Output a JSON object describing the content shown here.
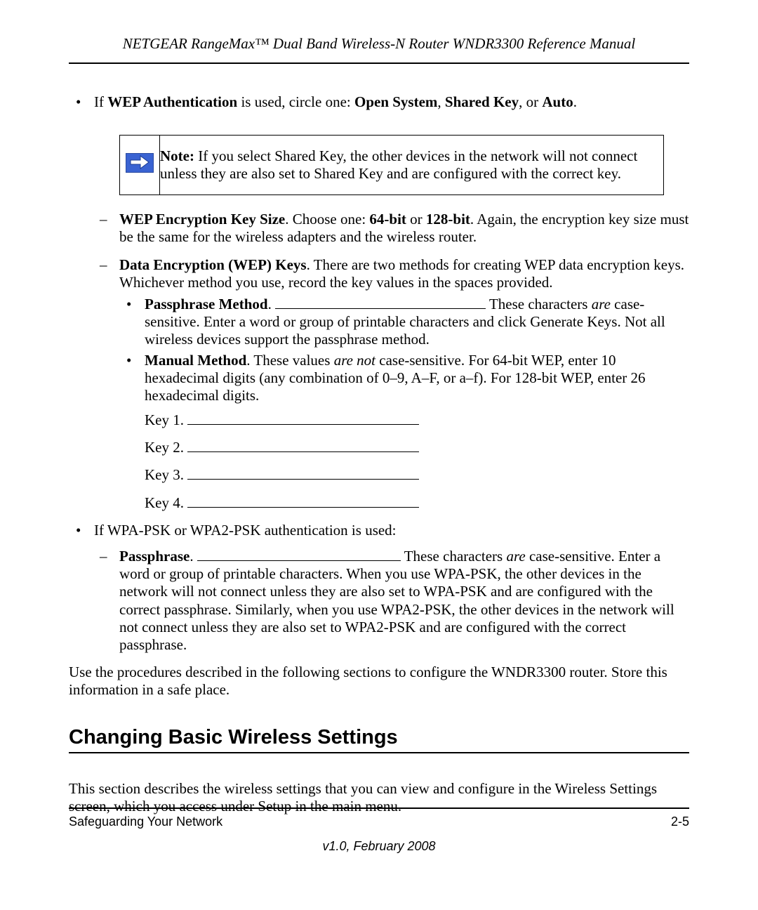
{
  "header": {
    "title": "NETGEAR RangeMax™ Dual Band Wireless-N Router WNDR3300 Reference Manual"
  },
  "bullets": {
    "wep_auth": {
      "prefix": "If ",
      "b1": "WEP Authentication",
      "mid1": " is used, circle one: ",
      "b2": "Open System",
      "sep1": ", ",
      "b3": "Shared Key",
      "sep2": ", or ",
      "b4": "Auto",
      "suffix": "."
    },
    "note": {
      "label": "Note:",
      "text1": " If you select Shared Key, the other devices in the network will not connect unless they are also set to Shared Key and are configured with the correct key."
    },
    "wep_keysize": {
      "b1": "WEP Encryption Key Size",
      "t1": ". Choose one: ",
      "b2": "64-bit",
      "t2": " or ",
      "b3": "128-bit",
      "t3": ". Again, the encryption key size must be the same for the wireless adapters and the wireless router."
    },
    "data_keys": {
      "b1": "Data Encryption (WEP) Keys",
      "t1": ". There are two methods for creating WEP data encryption keys. Whichever method you use, record the key values in the spaces provided."
    },
    "passphrase_method": {
      "b1": "Passphrase Method",
      "dot": ". ",
      "t1": " These characters ",
      "i1": "are",
      "t2": " case-sensitive. Enter a word or group of printable characters and click Generate Keys. Not all wireless devices support the passphrase method."
    },
    "manual_method": {
      "b1": "Manual Method",
      "t1": ". These values ",
      "i1": "are not",
      "t2": " case-sensitive. For 64-bit WEP, enter 10 hexadecimal digits (any combination of 0–9, A–F, or a–f). For 128-bit WEP, enter 26 hexadecimal digits."
    },
    "keys": {
      "k1": "Key 1. ",
      "k2": "Key 2. ",
      "k3": "Key 3. ",
      "k4": "Key 4. "
    },
    "wpa_intro": "If WPA-PSK or WPA2-PSK authentication is used:",
    "wpa_passphrase": {
      "b1": "Passphrase",
      "dot": ". ",
      "t1": " These characters ",
      "i1": "are",
      "t2": " case-sensitive. Enter a word or group of printable characters. When you use WPA-PSK, the other devices in the network will not connect unless they are also set to WPA-PSK and are configured with the correct passphrase. Similarly, when you use WPA2-PSK, the other devices in the network will not connect unless they are also set to WPA2-PSK and are configured with the correct passphrase."
    }
  },
  "closing": "Use the procedures described in the following sections to configure the WNDR3300 router. Store this information in a safe place.",
  "section": {
    "heading": "Changing Basic Wireless Settings",
    "intro": "This section describes the wireless settings that you can view and configure in the Wireless Settings screen, which you access under Setup in the main menu."
  },
  "footer": {
    "left": "Safeguarding Your Network",
    "right": "2-5",
    "version": "v1.0, February 2008"
  }
}
